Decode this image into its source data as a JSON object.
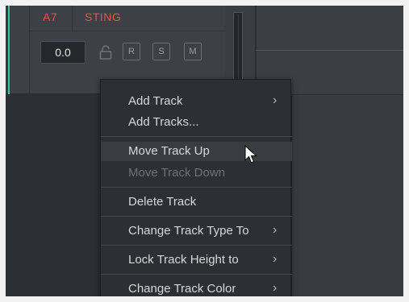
{
  "track": {
    "id": "A7",
    "name": "STING",
    "volume": "0.0",
    "buttons": {
      "record": "R",
      "solo": "S",
      "mute": "M"
    },
    "accent_color": "#e0564e",
    "strip_color": "#3cc8a0"
  },
  "context_menu": {
    "items": [
      {
        "label": "Add Track",
        "submenu": true
      },
      {
        "label": "Add Tracks...",
        "submenu": false
      },
      {
        "label": "Move Track Up",
        "submenu": false,
        "highlighted": true
      },
      {
        "label": "Move Track Down",
        "submenu": false,
        "disabled": true
      },
      {
        "label": "Delete Track",
        "submenu": false
      },
      {
        "label": "Change Track Type To",
        "submenu": true
      },
      {
        "label": "Lock Track Height to",
        "submenu": true
      },
      {
        "label": "Change Track Color",
        "submenu": true
      }
    ],
    "chevron": "›"
  },
  "icons": {
    "lock": "lock-icon",
    "cursor": "mouse-pointer-icon",
    "submenu": "chevron-right-icon"
  }
}
